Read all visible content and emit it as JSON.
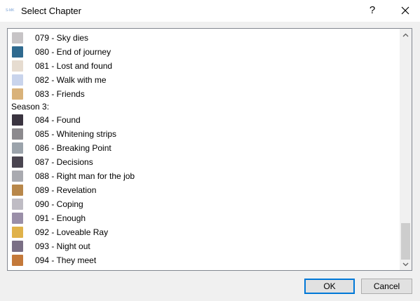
{
  "window": {
    "app_icon_text": "S-MK",
    "title": "Select Chapter",
    "help_label": "?"
  },
  "list": {
    "rows": [
      {
        "kind": "item",
        "label": "079 - Sky dies",
        "thumb_color": "#c7c4c6"
      },
      {
        "kind": "item",
        "label": "080 - End of journey",
        "thumb_color": "#2f6a8f"
      },
      {
        "kind": "item",
        "label": "081 - Lost and found",
        "thumb_color": "#e6dcd0"
      },
      {
        "kind": "item",
        "label": "082 - Walk with me",
        "thumb_color": "#c9d4ec"
      },
      {
        "kind": "item",
        "label": "083 - Friends",
        "thumb_color": "#d9b27a"
      },
      {
        "kind": "header",
        "label": "Season 3:"
      },
      {
        "kind": "item",
        "label": "084 - Found",
        "thumb_color": "#3a3440"
      },
      {
        "kind": "item",
        "label": "085 - Whitening strips",
        "thumb_color": "#8c8a8e"
      },
      {
        "kind": "item",
        "label": "086 - Breaking Point",
        "thumb_color": "#9ba3ab"
      },
      {
        "kind": "item",
        "label": "087 - Decisions",
        "thumb_color": "#4a4550"
      },
      {
        "kind": "item",
        "label": "088 - Right man for the job",
        "thumb_color": "#a9aab0"
      },
      {
        "kind": "item",
        "label": "089 - Revelation",
        "thumb_color": "#b8874a"
      },
      {
        "kind": "item",
        "label": "090 - Coping",
        "thumb_color": "#bfbcc4"
      },
      {
        "kind": "item",
        "label": "091 - Enough",
        "thumb_color": "#9a8fa8"
      },
      {
        "kind": "item",
        "label": "092 - Loveable Ray",
        "thumb_color": "#e0b24a"
      },
      {
        "kind": "item",
        "label": "093 - Night out",
        "thumb_color": "#7a6f85"
      },
      {
        "kind": "item",
        "label": "094 - They meet",
        "thumb_color": "#c4793a"
      }
    ]
  },
  "scrollbar": {
    "position_fraction": 0.92
  },
  "buttons": {
    "ok_label": "OK",
    "cancel_label": "Cancel"
  }
}
